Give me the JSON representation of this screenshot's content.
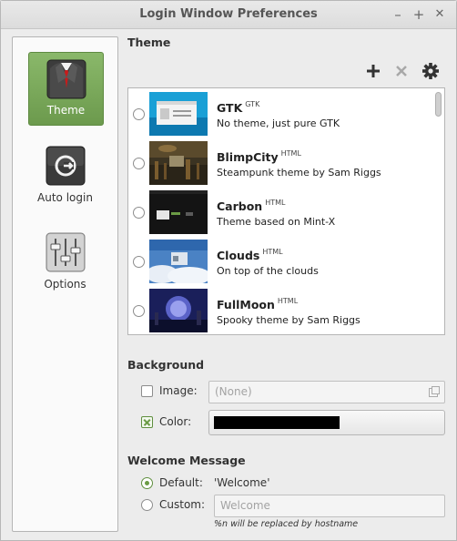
{
  "window": {
    "title": "Login Window Preferences",
    "minimize": "–",
    "maximize": "+",
    "close": "✕"
  },
  "sidebar": {
    "items": [
      {
        "label": "Theme",
        "icon": "suit-icon"
      },
      {
        "label": "Auto login",
        "icon": "power-icon"
      },
      {
        "label": "Options",
        "icon": "sliders-icon"
      }
    ],
    "active_color": "#7aa85a"
  },
  "theme": {
    "heading": "Theme",
    "toolbar": {
      "add": "add-icon",
      "remove": "remove-icon",
      "settings": "gear-icon"
    },
    "items": [
      {
        "name": "GTK",
        "type": "GTK",
        "desc": "No theme, just pure GTK"
      },
      {
        "name": "BlimpCity",
        "type": "HTML",
        "desc": "Steampunk theme by Sam Riggs"
      },
      {
        "name": "Carbon",
        "type": "HTML",
        "desc": "Theme based on Mint-X"
      },
      {
        "name": "Clouds",
        "type": "HTML",
        "desc": "On top of the clouds"
      },
      {
        "name": "FullMoon",
        "type": "HTML",
        "desc": "Spooky theme by Sam Riggs"
      }
    ]
  },
  "background": {
    "heading": "Background",
    "image_label": "Image:",
    "image_checked": false,
    "image_value": "(None)",
    "color_label": "Color:",
    "color_checked": true,
    "color_value": "#000000"
  },
  "welcome": {
    "heading": "Welcome Message",
    "default_label": "Default:",
    "default_value": "'Welcome'",
    "custom_label": "Custom:",
    "custom_placeholder": "Welcome",
    "hint": "%n will be replaced by hostname",
    "selected": "default"
  },
  "colors": {
    "accent": "#6b9b45"
  }
}
